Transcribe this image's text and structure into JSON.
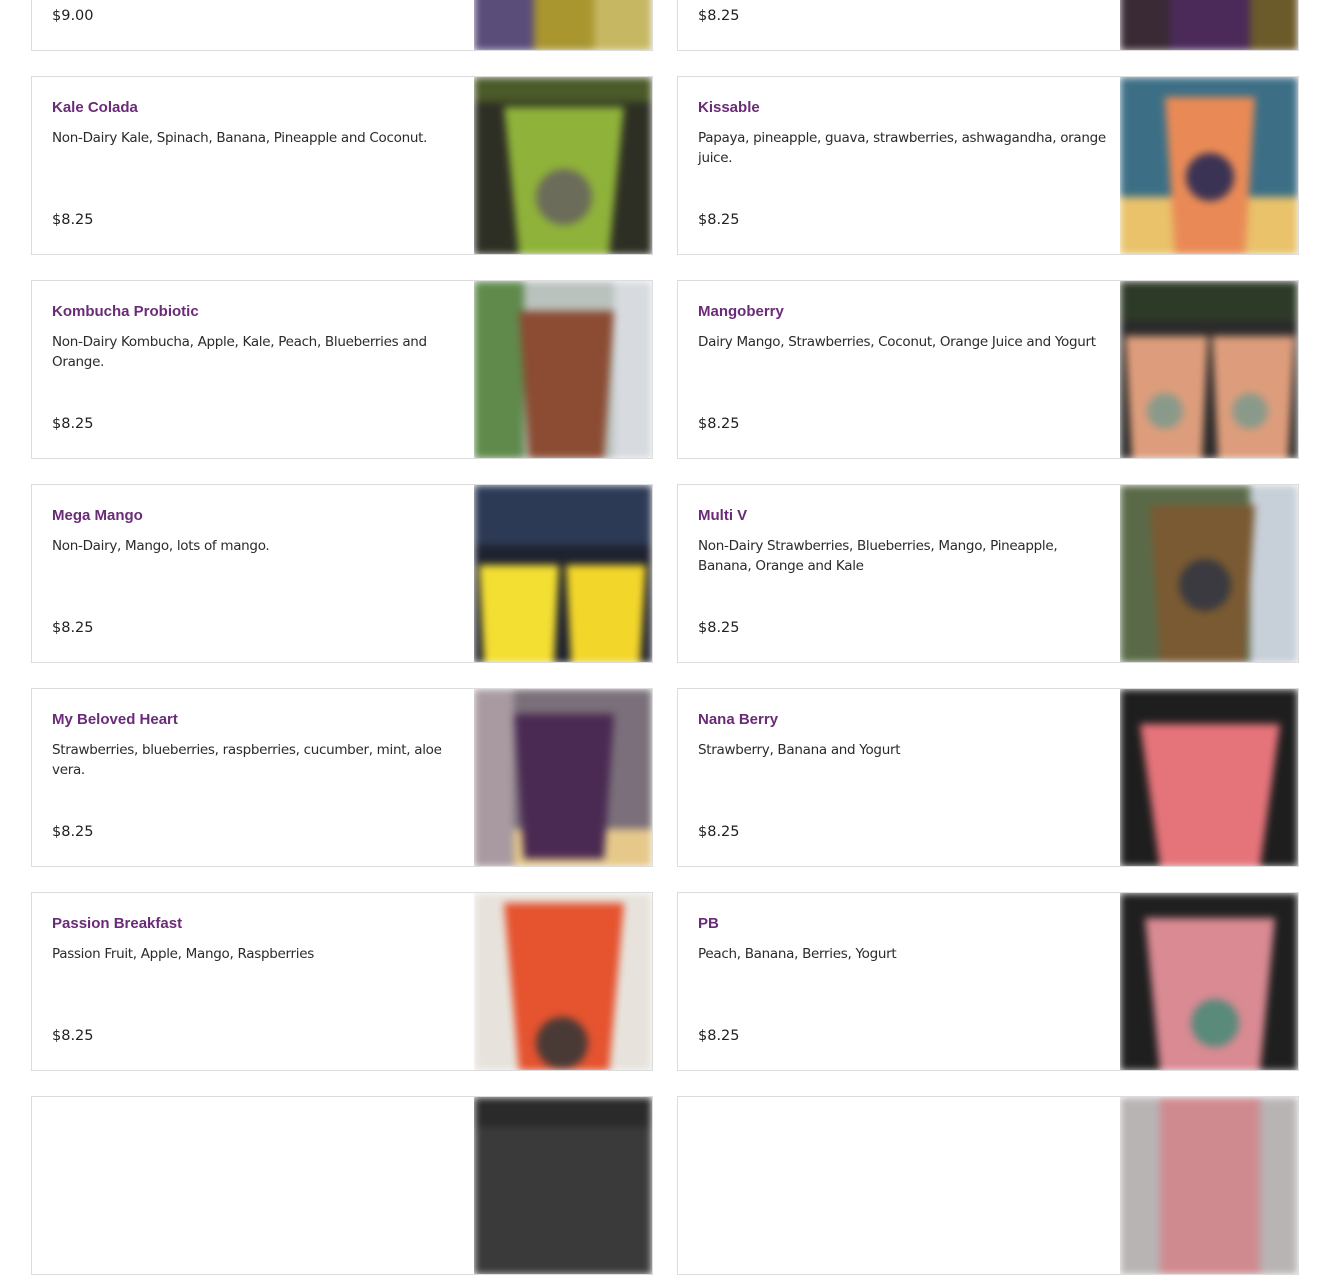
{
  "menu_items": [
    {
      "name": "",
      "description": "",
      "price": "$9.00",
      "image": "smoothie-photo-purple-yellow",
      "accent": "#6a2b77"
    },
    {
      "name": "",
      "description": "",
      "price": "$8.25",
      "image": "smoothie-photo-dark-purple"
    },
    {
      "name": "Kale Colada",
      "description": "Non-Dairy Kale, Spinach, Banana, Pineapple and Coconut.",
      "price": "$8.25",
      "image": "smoothie-photo-green"
    },
    {
      "name": "Kissable",
      "description": "Papaya, pineapple, guava, strawberries, ashwagandha, orange juice.",
      "price": "$8.25",
      "image": "smoothie-photo-orange"
    },
    {
      "name": "Kombucha Probiotic",
      "description": "Non-Dairy Kombucha, Apple, Kale, Peach, Blueberries and Orange.",
      "price": "$8.25",
      "image": "smoothie-photo-brown"
    },
    {
      "name": "Mangoberry",
      "description": "Dairy Mango, Strawberries, Coconut, Orange Juice and Yogurt",
      "price": "$8.25",
      "image": "smoothie-photo-peach-pair"
    },
    {
      "name": "Mega Mango",
      "description": "Non-Dairy, Mango, lots of mango.",
      "price": "$8.25",
      "image": "smoothie-photo-yellow-pair"
    },
    {
      "name": "Multi V",
      "description": "Non-Dairy Strawberries, Blueberries, Mango, Pineapple, Banana, Orange and Kale",
      "price": "$8.25",
      "image": "smoothie-photo-brown-cup"
    },
    {
      "name": "My Beloved Heart",
      "description": "Strawberries, blueberries, raspberries, cucumber, mint, aloe vera.",
      "price": "$8.25",
      "image": "smoothie-photo-dark-red"
    },
    {
      "name": "Nana Berry",
      "description": "Strawberry, Banana and Yogurt",
      "price": "$8.25",
      "image": "smoothie-photo-pink"
    },
    {
      "name": "Passion Breakfast",
      "description": "Passion Fruit, Apple, Mango, Raspberries",
      "price": "$8.25",
      "image": "smoothie-photo-red-orange"
    },
    {
      "name": "PB",
      "description": "Peach, Banana, Berries, Yogurt",
      "price": "$8.25",
      "image": "smoothie-photo-light-pink"
    },
    {
      "name": "",
      "description": "",
      "price": "",
      "image": "smoothie-photo-dark"
    },
    {
      "name": "",
      "description": "",
      "price": "",
      "image": "smoothie-photo-pink-gray"
    }
  ]
}
